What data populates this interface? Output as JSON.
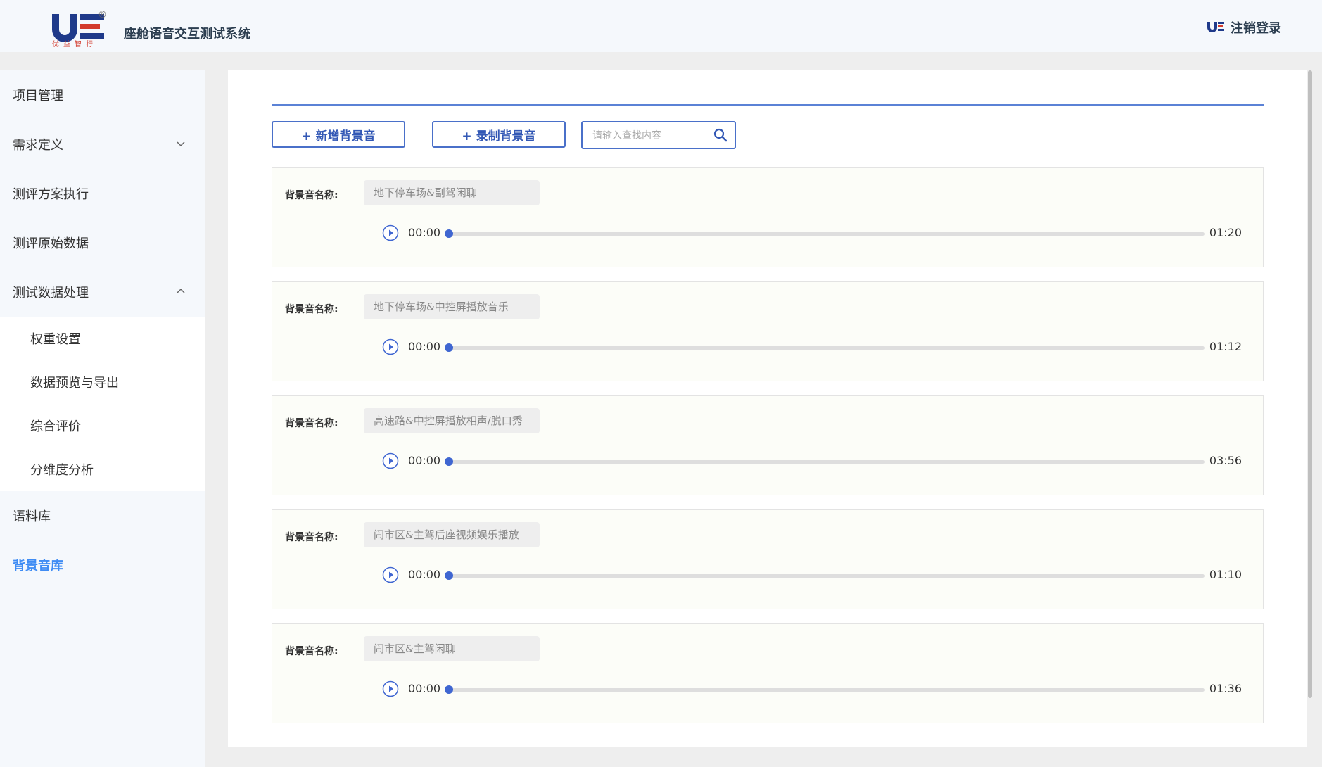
{
  "header": {
    "logo_sub": "优益智行",
    "registered": "®",
    "title": "座舱语音交互测试系统",
    "logout_label": "注销登录"
  },
  "sidebar": {
    "items": [
      {
        "label": "项目管理"
      },
      {
        "label": "需求定义"
      },
      {
        "label": "测评方案执行"
      },
      {
        "label": "测评原始数据"
      },
      {
        "label": "测试数据处理"
      },
      {
        "label": "语料库"
      },
      {
        "label": "背景音库"
      }
    ],
    "sub_items": [
      {
        "label": "权重设置"
      },
      {
        "label": "数据预览与导出"
      },
      {
        "label": "综合评价"
      },
      {
        "label": "分维度分析"
      }
    ]
  },
  "toolbar": {
    "add_label": "+ 新增背景音",
    "record_label": "+ 录制背景音",
    "search_placeholder": "请输入查找内容"
  },
  "cards": [
    {
      "label": "背景音名称:",
      "name": "地下停车场&副驾闲聊",
      "current": "00:00",
      "duration": "01:20"
    },
    {
      "label": "背景音名称:",
      "name": "地下停车场&中控屏播放音乐",
      "current": "00:00",
      "duration": "01:12"
    },
    {
      "label": "背景音名称:",
      "name": "高速路&中控屏播放相声/脱口秀",
      "current": "00:00",
      "duration": "03:56"
    },
    {
      "label": "背景音名称:",
      "name": "闹市区&主驾后座视频娱乐播放",
      "current": "00:00",
      "duration": "01:10"
    },
    {
      "label": "背景音名称:",
      "name": "闹市区&主驾闲聊",
      "current": "00:00",
      "duration": "01:36"
    }
  ],
  "colors": {
    "accent": "#3f8cf4",
    "button_border": "#4a70c9",
    "progress_knob": "#3f66d1"
  }
}
